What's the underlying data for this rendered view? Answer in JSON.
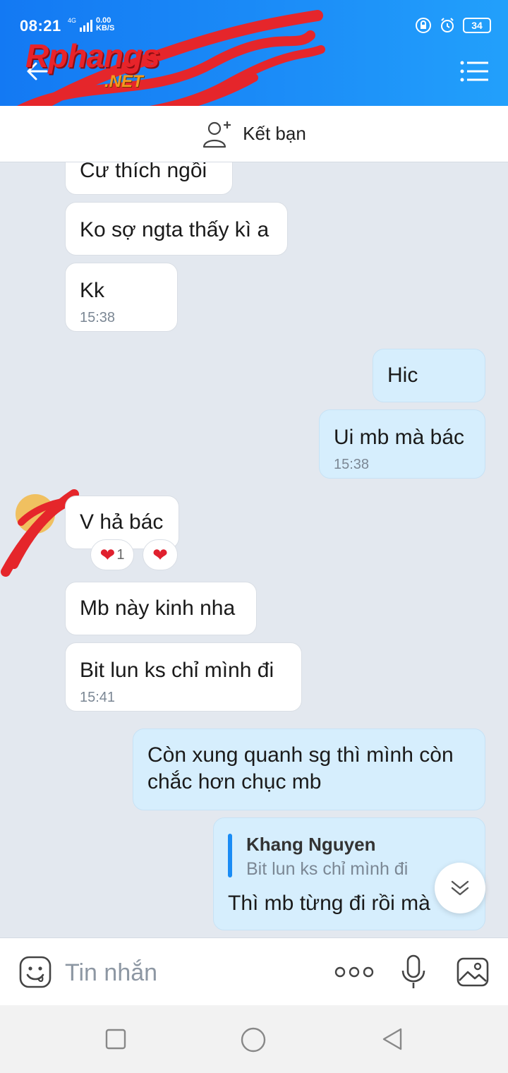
{
  "status_bar": {
    "time": "08:21",
    "network": "4G",
    "speed_value": "0.00",
    "speed_unit": "KB/S",
    "battery": "34"
  },
  "watermark": {
    "brand": "Rphangs",
    "suffix": ".NET"
  },
  "friend_bar": {
    "label": "Kết bạn"
  },
  "messages": [
    {
      "side": "in",
      "text": "Cư thích ngồi",
      "time": ""
    },
    {
      "side": "in",
      "text": "Ko sợ ngta thấy kì a",
      "time": ""
    },
    {
      "side": "in",
      "text": "Kk",
      "time": "15:38"
    },
    {
      "side": "out",
      "text": "Hic",
      "time": ""
    },
    {
      "side": "out",
      "text": "Ui mb mà bác",
      "time": "15:38"
    },
    {
      "side": "in",
      "text": "V hả bác",
      "time": ""
    },
    {
      "side": "in",
      "text": "Mb này kinh nha",
      "time": ""
    },
    {
      "side": "in",
      "text": "Bit lun ks chỉ mình đi",
      "time": "15:41"
    },
    {
      "side": "out",
      "text_line1": "Còn xung quanh sg thì mình còn",
      "text_line2": "chắc hơn chục mb",
      "time": ""
    },
    {
      "side": "out",
      "reply_name": "Khang Nguyen",
      "reply_text": "Bit lun ks chỉ mình đi",
      "text": "Thì mb từng đi rồi mà",
      "time": ""
    }
  ],
  "reactions": {
    "heart_count": "1"
  },
  "input": {
    "placeholder": "Tin nhắn"
  },
  "colors": {
    "header": "#1c8ef8",
    "outgoing_bubble": "#d6eefd",
    "incoming_bubble": "#ffffff",
    "chat_background": "#e3e8ef",
    "accent": "#1a8cf5"
  }
}
